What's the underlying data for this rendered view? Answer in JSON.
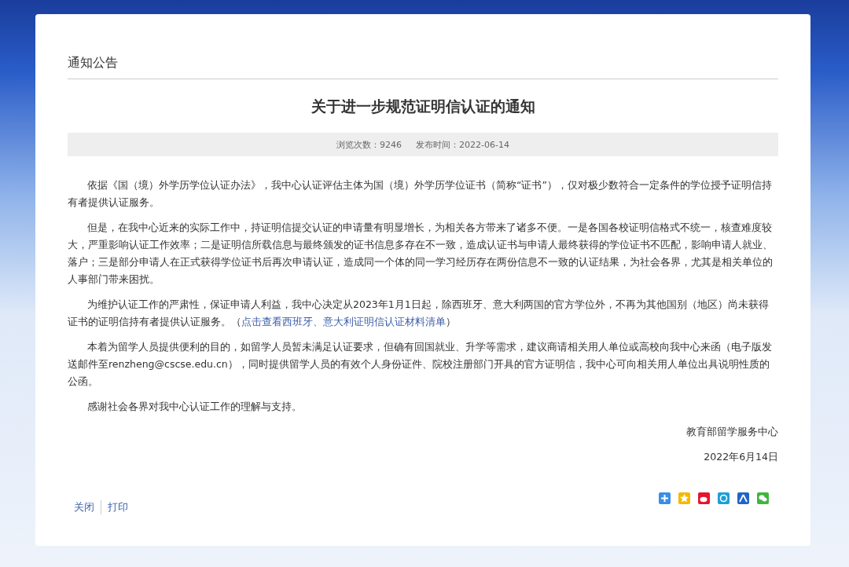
{
  "section_title": "通知公告",
  "article": {
    "title": "关于进一步规范证明信认证的通知",
    "views": "浏览次数：9246",
    "published": "发布时间：2022-06-14",
    "paragraphs": [
      {
        "text": "依据《国（境）外学历学位认证办法》，我中心认证评估主体为国（境）外学历学位证书（简称“证书”），仅对极少数符合一定条件的学位授予证明信持有者提供认证服务。"
      },
      {
        "text": "但是，在我中心近来的实际工作中，持证明信提交认证的申请量有明显增长，为相关各方带来了诸多不便。一是各国各校证明信格式不统一，核查难度较大，严重影响认证工作效率；二是证明信所载信息与最终颁发的证书信息多存在不一致，造成认证书与申请人最终获得的学位证书不匹配，影响申请人就业、落户；三是部分申请人在正式获得学位证书后再次申请认证，造成同一个体的同一学习经历存在两份信息不一致的认证结果，为社会各界，尤其是相关单位的人事部门带来困扰。"
      },
      {
        "text": "为维护认证工作的严肃性，保证申请人利益，我中心决定从2023年1月1日起，除西班牙、意大利两国的官方学位外，不再为其他国别（地区）尚未获得证书的证明信持有者提供认证服务。（",
        "link": "点击查看西班牙、意大利证明信认证材料清单",
        "after": "）"
      },
      {
        "text": "本着为留学人员提供便利的目的，如留学人员暂未满足认证要求，但确有回国就业、升学等需求，建议商请相关用人单位或高校向我中心来函（电子版发送邮件至renzheng@cscse.edu.cn），同时提供留学人员的有效个人身份证件、院校注册部门开具的官方证明信，我中心可向相关用人单位出具说明性质的公函。"
      },
      {
        "text": "感谢社会各界对我中心认证工作的理解与支持。"
      }
    ],
    "signature": "教育部留学服务中心",
    "date": "2022年6月14日"
  },
  "footer_links": [
    "关闭",
    "打印"
  ],
  "share_icons": [
    {
      "kind": "plus",
      "color": "#3a8ee6"
    },
    {
      "kind": "star",
      "color": "#f5b800"
    },
    {
      "kind": "weibo",
      "color": "#e6162d"
    },
    {
      "kind": "pay",
      "color": "#1e9fd6"
    },
    {
      "kind": "person",
      "color": "#2164c8"
    },
    {
      "kind": "wechat",
      "color": "#3fb53f"
    }
  ]
}
